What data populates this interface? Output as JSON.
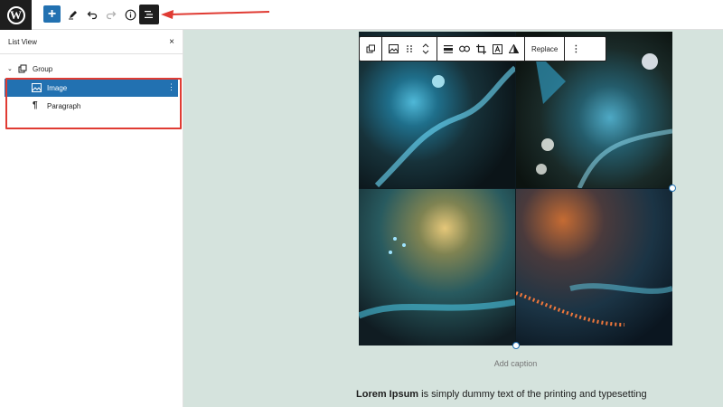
{
  "sidebar": {
    "title": "List View",
    "close_glyph": "×",
    "items": [
      {
        "label": "Group",
        "icon": "group-icon"
      },
      {
        "label": "Image",
        "icon": "image-icon",
        "selected": true
      },
      {
        "label": "Paragraph",
        "icon": "paragraph-icon"
      }
    ]
  },
  "toolbar": {
    "add_label": "+",
    "replace_label": "Replace"
  },
  "image": {
    "caption_placeholder": "Add caption"
  },
  "paragraph": {
    "bold_text": "Lorem Ipsum",
    "rest_text": " is simply dummy text of the printing and typesetting"
  },
  "colors": {
    "accent": "#2271b1",
    "annotation": "#e03b33",
    "canvas_bg": "#d5e3dd",
    "dark": "#1e1e1e"
  }
}
